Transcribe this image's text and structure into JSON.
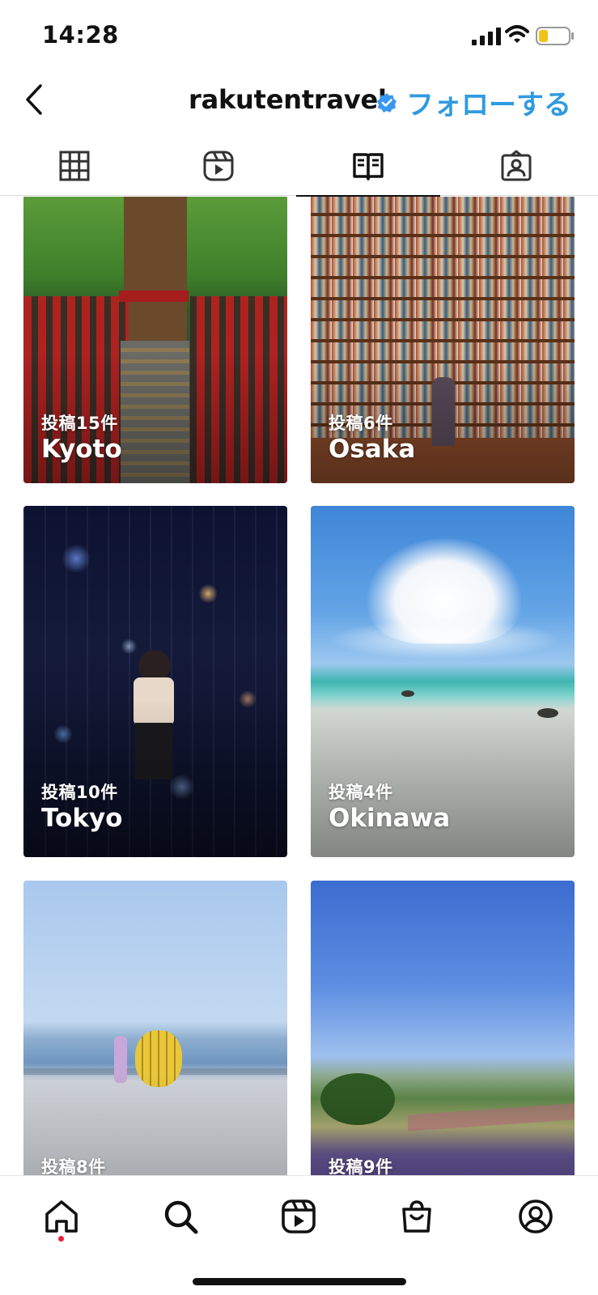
{
  "status_bar": {
    "time": "14:28",
    "icons": [
      "signal-icon",
      "wifi-icon",
      "battery-icon"
    ]
  },
  "header": {
    "username": "rakutentravel",
    "verified_icon": "verified-badge-icon",
    "follow_label": "フォローする",
    "back_icon": "chevron-left-icon"
  },
  "tabs": [
    {
      "icon": "grid-icon",
      "active": false
    },
    {
      "icon": "reels-icon",
      "active": false
    },
    {
      "icon": "guide-icon",
      "active": true
    },
    {
      "icon": "tagged-icon",
      "active": false
    }
  ],
  "guides": [
    {
      "count": "投稿15件",
      "name": "Kyoto"
    },
    {
      "count": "投稿6件",
      "name": "Osaka"
    },
    {
      "count": "投稿10件",
      "name": "Tokyo"
    },
    {
      "count": "投稿4件",
      "name": "Okinawa"
    },
    {
      "count": "投稿8件",
      "name": ""
    },
    {
      "count": "投稿9件",
      "name": ""
    }
  ],
  "bottom_nav": [
    {
      "icon": "home-icon"
    },
    {
      "icon": "search-icon"
    },
    {
      "icon": "reels-icon"
    },
    {
      "icon": "shop-icon"
    },
    {
      "icon": "profile-icon"
    }
  ],
  "colors": {
    "accent": "#2f9ae0",
    "notification_dot": "#ed1c3a",
    "verified": "#3897f0"
  }
}
